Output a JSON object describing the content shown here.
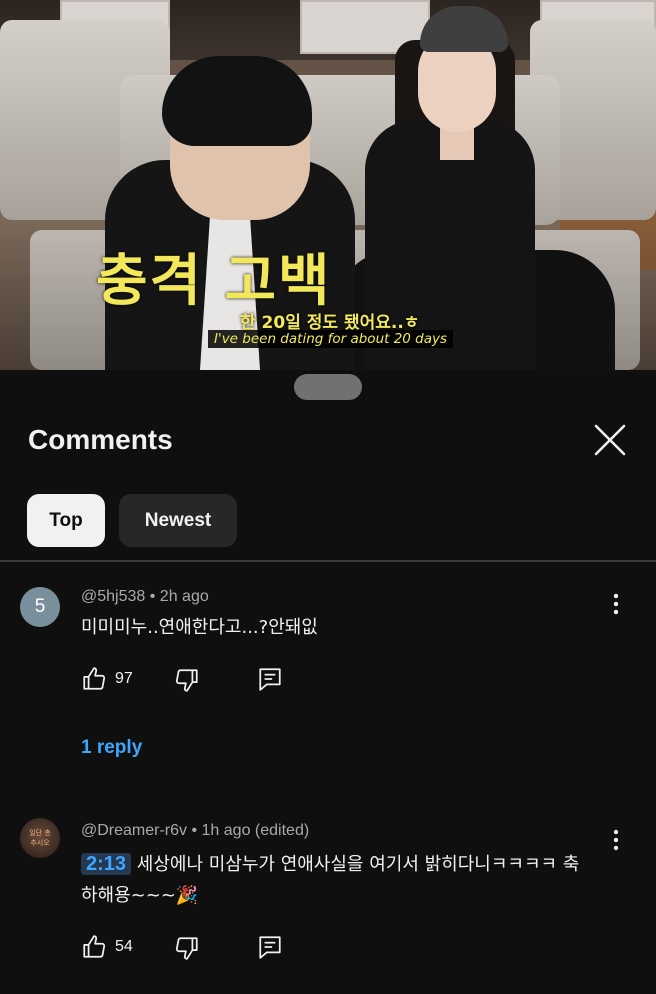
{
  "video": {
    "overlay_title": "충격 고백",
    "subtitle_ko": "한 20일 정도 됐어요..ㅎ",
    "subtitle_en": "I've been dating for about 20 days"
  },
  "sheet": {
    "title": "Comments",
    "close_icon": "close-icon",
    "sort_chips": [
      {
        "label": "Top",
        "selected": true
      },
      {
        "label": "Newest",
        "selected": false
      }
    ]
  },
  "comments": [
    {
      "avatar_letter": "5",
      "author": "@5hj538",
      "time": "2h ago",
      "text": "미미미누..연애한다고...?안돼잆",
      "likes": "97",
      "reply_link": "1 reply"
    },
    {
      "avatar_text": "일단 총\n추시오",
      "author": "@Dreamer-r6v",
      "time": "1h ago (edited)",
      "timestamp_link": "2:13",
      "text_line1": "세상에나 미삼누가 연애사실을 여기서 밝히다니ㅋㅋㅋㅋ 축",
      "text_line2": "하해용~~~🎉",
      "likes": "54"
    }
  ],
  "colors": {
    "background": "#0f0f0f",
    "link_blue": "#3ea6ff",
    "chip_selected": "#f1f1f1",
    "chip_unselected": "#272727",
    "subtitle_yellow": "#f2e85a"
  }
}
